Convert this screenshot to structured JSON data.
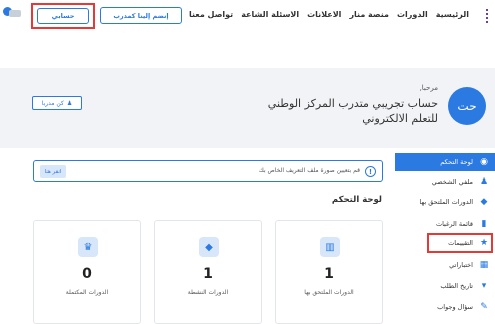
{
  "header": {
    "nav": [
      "الرئيسية",
      "الدورات",
      "منصة منار",
      "الاعلانات",
      "الاسئلة الشاعة",
      "تواصل معنا"
    ],
    "join_label": "إنضم إلينا كمدرب",
    "account_label": "حسابي",
    "logo_icon": "grid-logo-icon",
    "accent_color": "#2a7ae2"
  },
  "profile": {
    "avatar_text": "حت",
    "welcome": "مرحبا,",
    "account_name": "حساب تجريبي متدرب المركز الوطني للتعلم الالكتروني",
    "trainer_label": "كن مدربا"
  },
  "sidebar": {
    "items": [
      {
        "label": "لوحة التحكم",
        "icon": "dashboard-icon",
        "glyph": "◉"
      },
      {
        "label": "ملفي الشخصي",
        "icon": "user-icon",
        "glyph": "♟"
      },
      {
        "label": "الدورات الملتحق بها",
        "icon": "graduation-cap-icon",
        "glyph": "◆"
      },
      {
        "label": "قائمة الرغبات",
        "icon": "bookmark-icon",
        "glyph": "▮"
      },
      {
        "label": "التقييمات",
        "icon": "star-icon",
        "glyph": "★"
      },
      {
        "label": "اختباراتي",
        "icon": "quiz-icon",
        "glyph": "▦"
      },
      {
        "label": "تاريخ الطلب",
        "icon": "cart-icon",
        "glyph": "▾"
      },
      {
        "label": "سؤال وجواب",
        "icon": "qa-icon",
        "glyph": "✎"
      }
    ]
  },
  "notice": {
    "text": "قم بتعيين صورة ملف التعريف الخاص بك",
    "button_label": "انقر هنا",
    "icon": "info-icon"
  },
  "dashboard": {
    "title": "لوحة التحكم",
    "cards": [
      {
        "count": "1",
        "label": "الدورات الملتحق بها",
        "icon": "book-icon",
        "glyph": "▥"
      },
      {
        "count": "1",
        "label": "الدورات النشطة",
        "icon": "graduation-cap-icon",
        "glyph": "◆"
      },
      {
        "count": "0",
        "label": "الدورات المكتملة",
        "icon": "trophy-icon",
        "glyph": "♛"
      }
    ]
  }
}
